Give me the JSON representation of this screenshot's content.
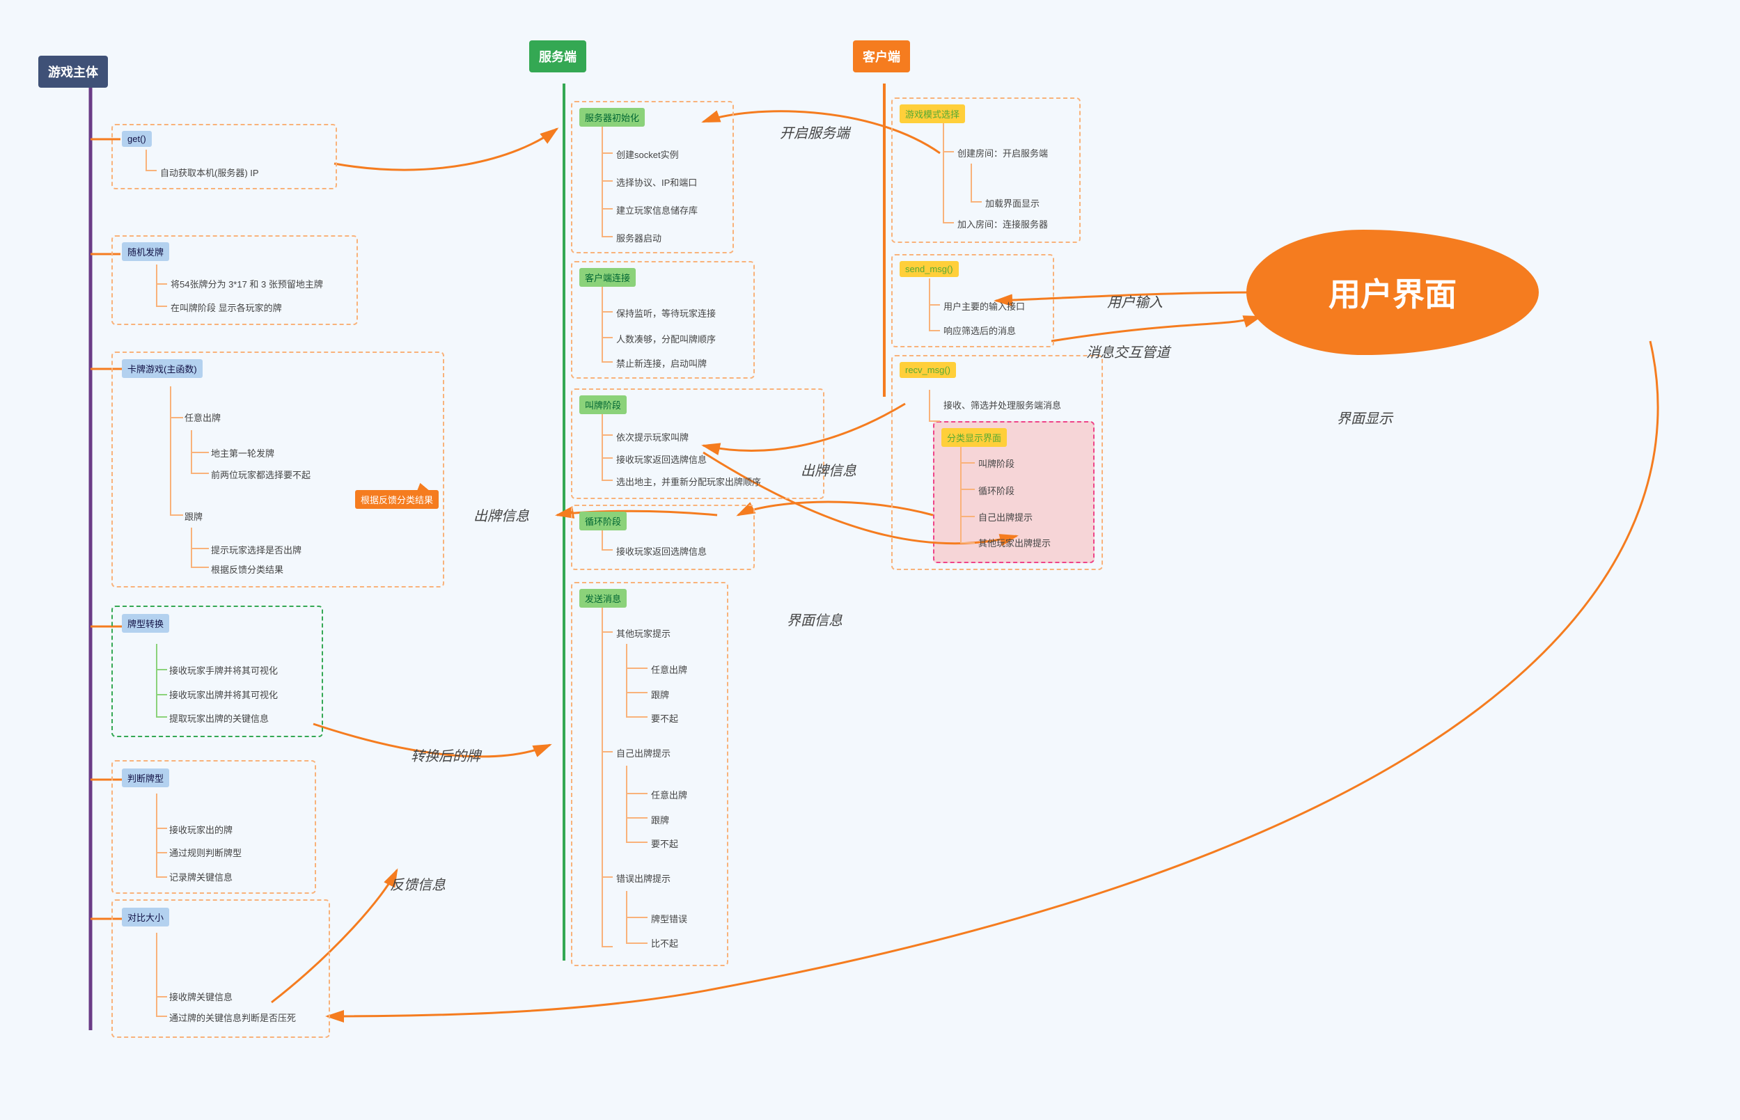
{
  "colors": {
    "navy": "#3f5177",
    "green": "#34a853",
    "orange": "#f57c1f",
    "yellow": "#ffcf3a",
    "lightgreen": "#8bd27a",
    "lightblue": "#b3d1ef",
    "pink": "#f6d5d7",
    "purple": "#6a3b86"
  },
  "roots": {
    "game": "游戏主体",
    "server": "服务端",
    "client": "客户端",
    "ui": "用户界面"
  },
  "edge_labels": {
    "open_server": "开启服务端",
    "user_input": "用户输入",
    "msg_channel": "消息交互管道",
    "ui_display": "界面显示",
    "out_info1": "出牌信息",
    "out_info2": "出牌信息",
    "ui_info": "界面信息",
    "after_conv": "转换后的牌",
    "feedback": "反馈信息",
    "classify": "根据反馈分类结果"
  },
  "game": {
    "get": {
      "title": "get()",
      "items": [
        "自动获取本机(服务器) IP"
      ]
    },
    "deal": {
      "title": "随机发牌",
      "items": [
        "将54张牌分为 3*17 和 3 张预留地主牌",
        "在叫牌阶段 显示各玩家的牌"
      ]
    },
    "main": {
      "title": "卡牌游戏(主函数)",
      "free": "任意出牌",
      "free_items": [
        "地主第一轮发牌",
        "前两位玩家都选择要不起"
      ],
      "follow": "跟牌",
      "follow_items": [
        "提示玩家选择是否出牌",
        "根据反馈分类结果"
      ]
    },
    "conv": {
      "title": "牌型转换",
      "items": [
        "接收玩家手牌并将其可视化",
        "接收玩家出牌并将其可视化",
        "提取玩家出牌的关键信息"
      ]
    },
    "judge": {
      "title": "判断牌型",
      "items": [
        "接收玩家出的牌",
        "通过规则判断牌型",
        "记录牌关键信息"
      ]
    },
    "compare": {
      "title": "对比大小",
      "items": [
        "接收牌关键信息",
        "通过牌的关键信息判断是否压死"
      ]
    }
  },
  "server": {
    "init": {
      "title": "服务器初始化",
      "items": [
        "创建socket实例",
        "选择协议、IP和端口",
        "建立玩家信息储存库",
        "服务器启动"
      ]
    },
    "conn": {
      "title": "客户端连接",
      "items": [
        "保持监听，等待玩家连接",
        "人数凑够，分配叫牌顺序",
        "禁止新连接，启动叫牌"
      ]
    },
    "bid": {
      "title": "叫牌阶段",
      "items": [
        "依次提示玩家叫牌",
        "接收玩家返回选牌信息",
        "选出地主，并重新分配玩家出牌顺序"
      ]
    },
    "loop": {
      "title": "循环阶段",
      "items": [
        "接收玩家返回选牌信息"
      ]
    },
    "send": {
      "title": "发送消息",
      "other": "其他玩家提示",
      "other_items": [
        "任意出牌",
        "跟牌",
        "要不起"
      ],
      "self": "自己出牌提示",
      "self_items": [
        "任意出牌",
        "跟牌",
        "要不起"
      ],
      "err": "错误出牌提示",
      "err_items": [
        "牌型错误",
        "比不起"
      ]
    }
  },
  "client": {
    "mode": {
      "title": "游戏模式选择",
      "create": "创建房间：开启服务端",
      "join_items": [
        "加载界面显示",
        "加入房间：连接服务器"
      ]
    },
    "send": {
      "title": "send_msg()",
      "items": [
        "用户主要的输入接口",
        "响应筛选后的消息"
      ]
    },
    "recv": {
      "title": "recv_msg()",
      "filter": "接收、筛选并处理服务端消息",
      "panel": "分类显示界面",
      "panel_items": [
        "叫牌阶段",
        "循环阶段",
        "自己出牌提示",
        "其他玩家出牌提示"
      ]
    }
  }
}
